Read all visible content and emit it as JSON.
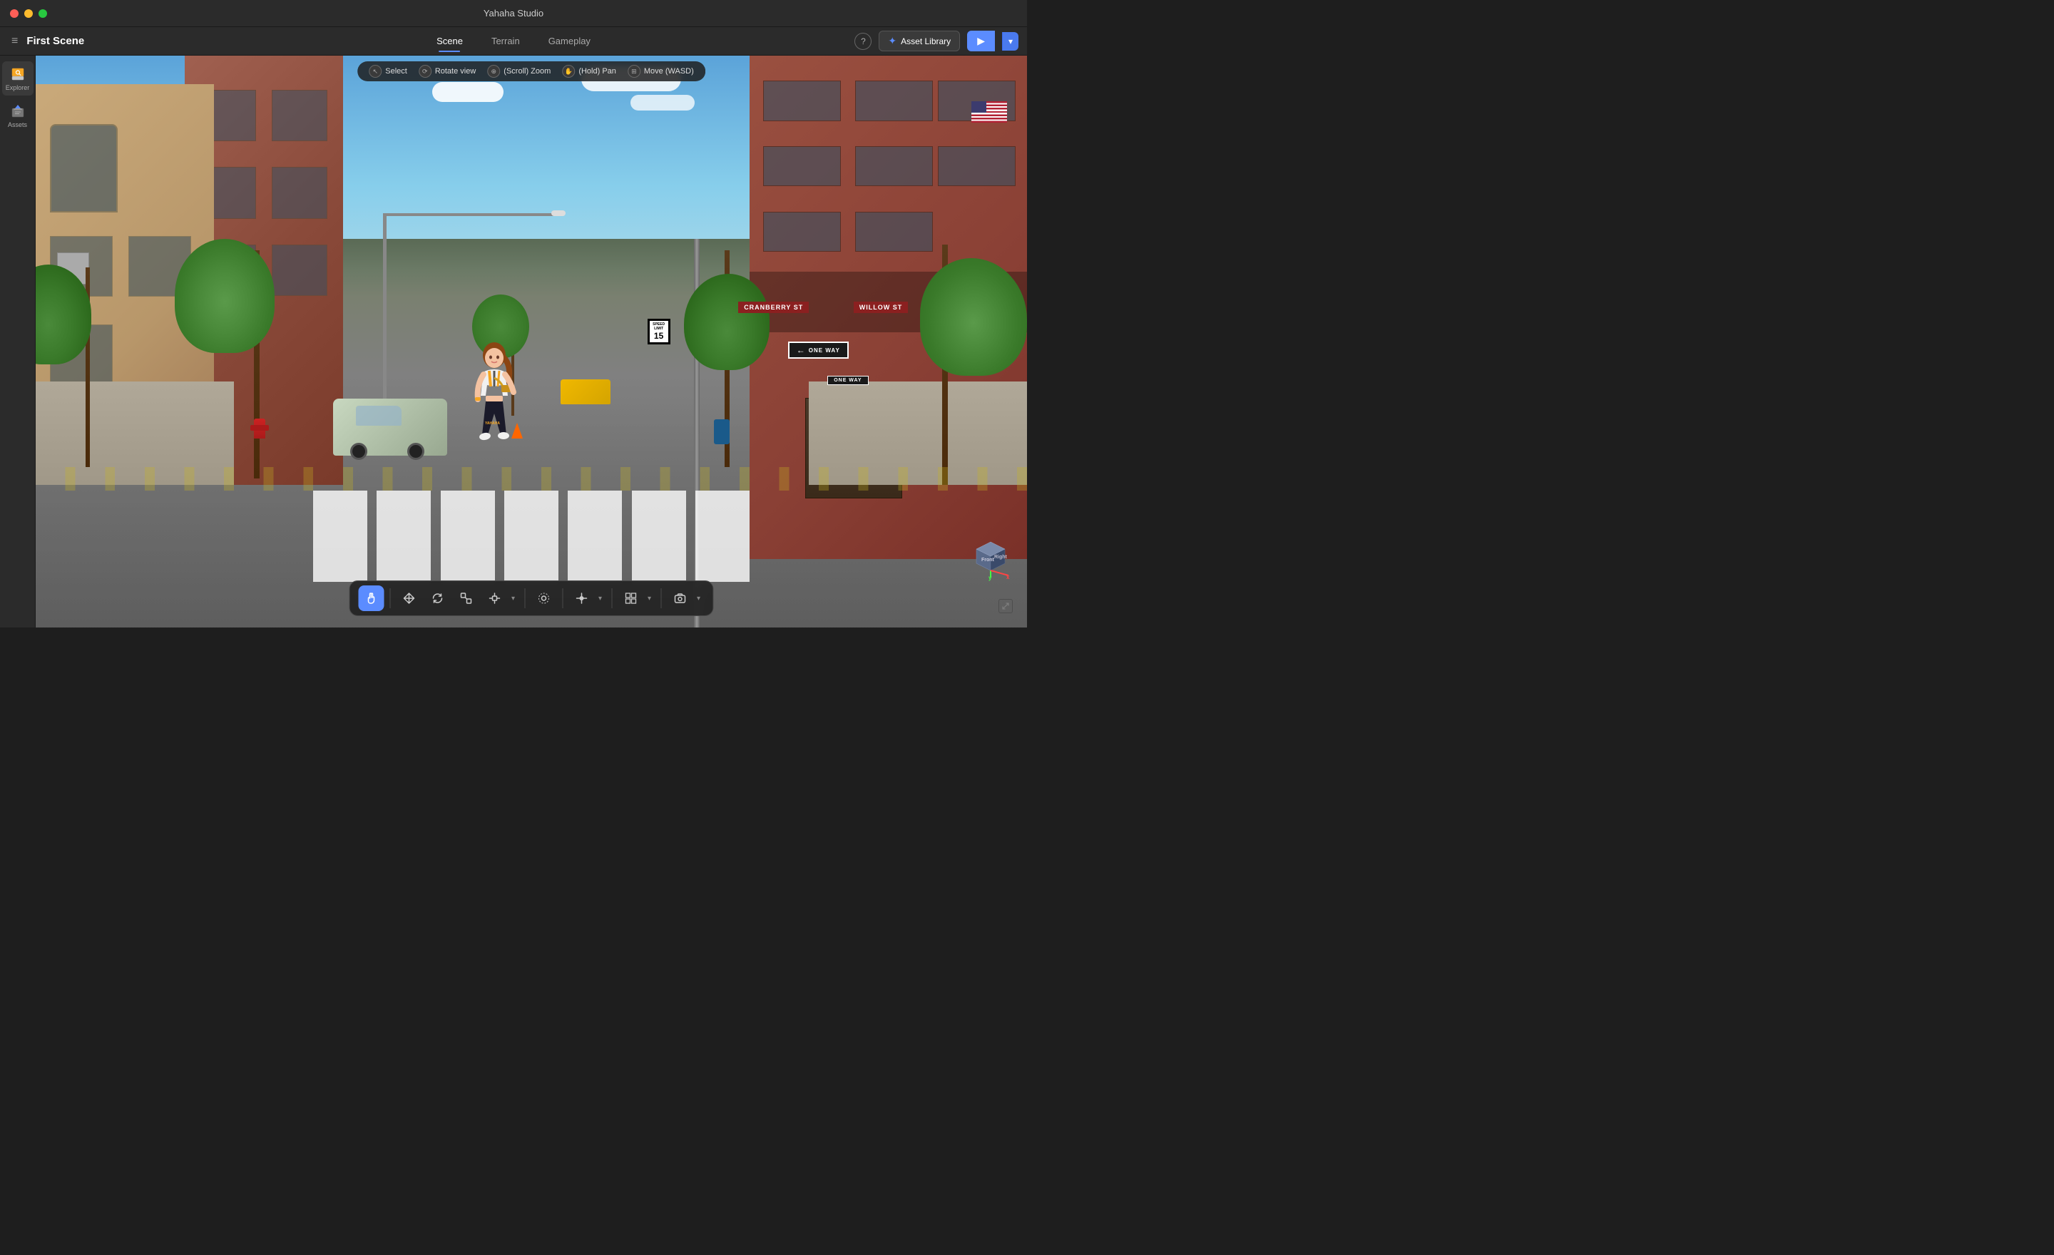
{
  "app": {
    "title": "Yahaha Studio",
    "window_title": "First Scene"
  },
  "titlebar": {
    "title": "Yahaha Studio",
    "traffic_lights": [
      "red",
      "yellow",
      "green"
    ]
  },
  "toolbar": {
    "scene_title": "First Scene",
    "tabs": [
      {
        "label": "Scene",
        "active": true
      },
      {
        "label": "Terrain",
        "active": false
      },
      {
        "label": "Gameplay",
        "active": false
      }
    ],
    "help_label": "?",
    "asset_library_label": "Asset Library",
    "play_label": "▶",
    "dropdown_label": "▾"
  },
  "sidebar": {
    "items": [
      {
        "label": "Explorer",
        "icon": "compass"
      },
      {
        "label": "Assets",
        "icon": "box"
      }
    ]
  },
  "viewport": {
    "tools": [
      {
        "icon": "cursor",
        "label": "Select"
      },
      {
        "icon": "rotate",
        "label": "Rotate view"
      },
      {
        "icon": "zoom",
        "label": "(Scroll) Zoom"
      },
      {
        "icon": "hand",
        "label": "(Hold) Pan"
      },
      {
        "icon": "move",
        "label": "Move (WASD)"
      }
    ]
  },
  "scene": {
    "signs": {
      "cranberry_st": "CRANBERRY ST",
      "willow_st": "WILLOW ST",
      "one_way_1": "ONE WAY",
      "one_way_2": "ONE WAY",
      "speed_limit_label": "SPEED LIMIT",
      "speed_limit_value": "15"
    }
  },
  "bottom_toolbar": {
    "tools": [
      {
        "icon": "hand",
        "active": true
      },
      {
        "icon": "move4",
        "active": false
      },
      {
        "icon": "rotate2",
        "active": false
      },
      {
        "icon": "scale",
        "active": false
      },
      {
        "icon": "transform",
        "active": false
      },
      {
        "icon": "pivot",
        "active": false
      },
      {
        "icon": "snap",
        "active": false
      },
      {
        "icon": "grid",
        "active": false
      },
      {
        "icon": "camera",
        "active": false
      }
    ]
  },
  "gizmo": {
    "front_label": "Front",
    "right_label": "Right"
  }
}
